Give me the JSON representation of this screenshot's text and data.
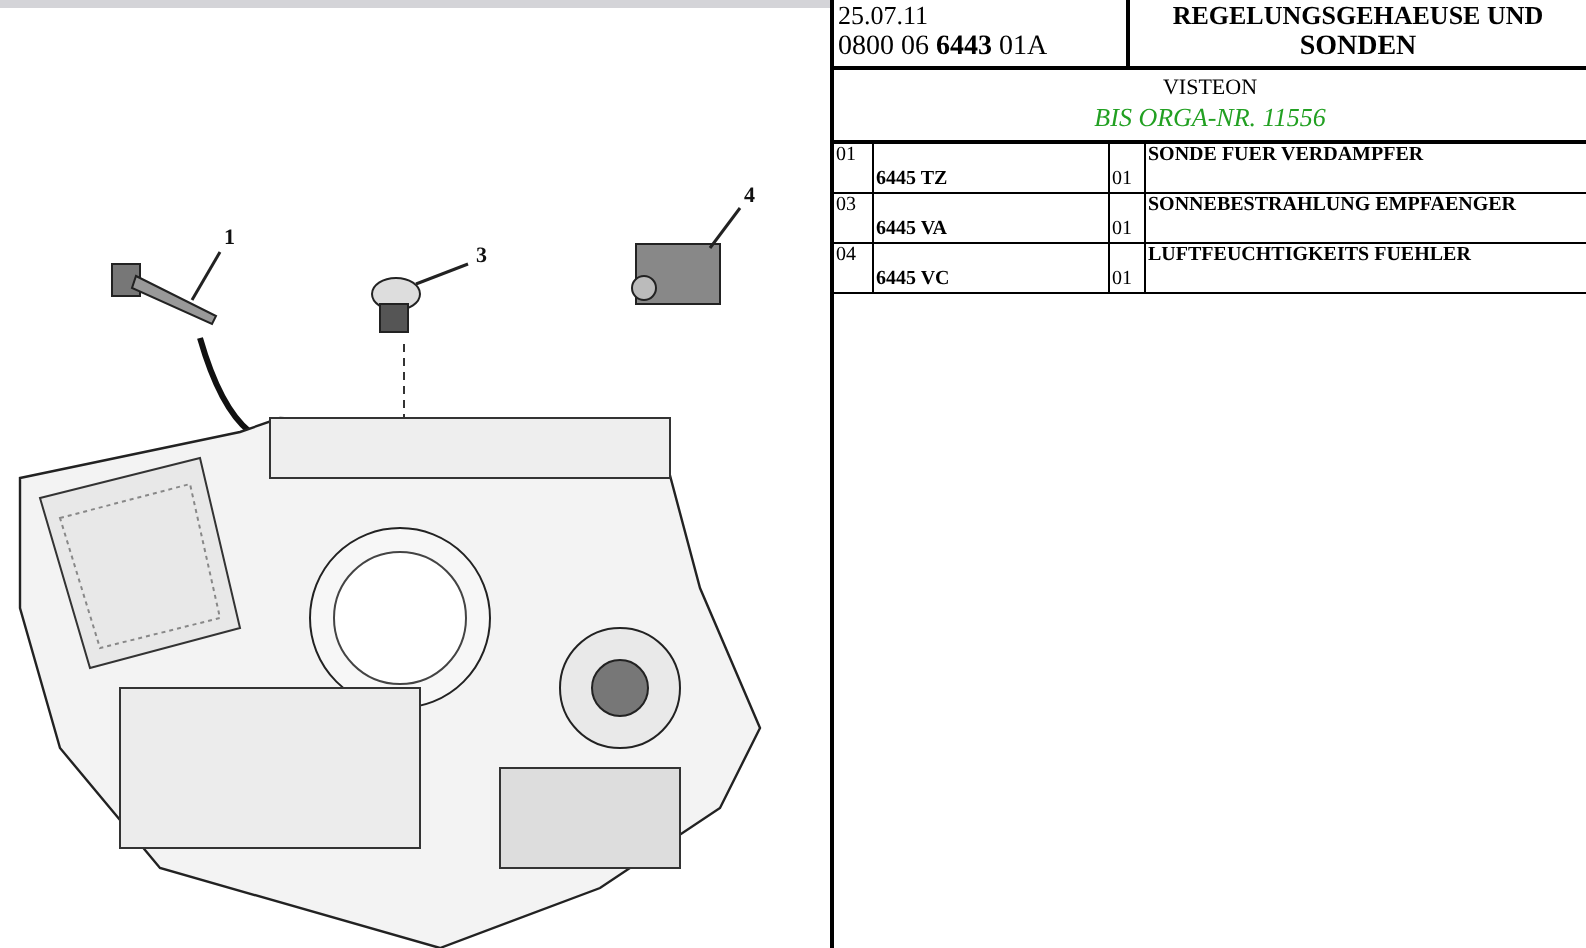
{
  "diagram": {
    "callouts": [
      "1",
      "3",
      "4"
    ]
  },
  "header": {
    "date": "25.07.11",
    "part_number_prefix": "0800 06",
    "part_number_bold": "6443",
    "part_number_suffix": "01A",
    "title_line_1": "REGELUNGSGEHAEUSE UND",
    "title_line_2": "SONDEN"
  },
  "supplier": {
    "name": "VISTEON",
    "note": "BIS ORGA-NR. 11556"
  },
  "parts": [
    {
      "index": "01",
      "reference": "6445 TZ",
      "quantity": "01",
      "description": "SONDE FUER VERDAMPFER"
    },
    {
      "index": "03",
      "reference": "6445 VA",
      "quantity": "01",
      "description": "SONNEBESTRAHLUNG EMPFAENGER"
    },
    {
      "index": "04",
      "reference": "6445 VC",
      "quantity": "01",
      "description": "LUFTFEUCHTIGKEITS FUEHLER"
    }
  ]
}
